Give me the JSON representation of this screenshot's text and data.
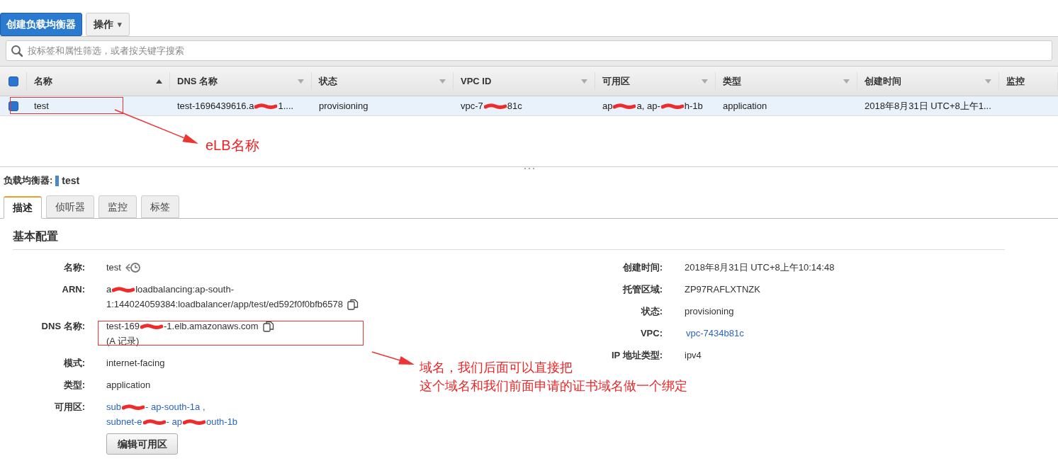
{
  "toolbar": {
    "create_button": "创建负载均衡器",
    "actions_button": {
      "label": "操作",
      "caret": "▾"
    }
  },
  "filter": {
    "placeholder": "按标签和属性筛选，或者按关键字搜索"
  },
  "table": {
    "select_all": {
      "checked": true
    },
    "columns": [
      {
        "label": "名称",
        "sorted": true
      },
      {
        "label": "DNS 名称",
        "sorted": false
      },
      {
        "label": "状态",
        "sorted": false
      },
      {
        "label": "VPC ID",
        "sorted": false
      },
      {
        "label": "可用区",
        "sorted": false
      },
      {
        "label": "类型",
        "sorted": false
      },
      {
        "label": "创建时间",
        "sorted": false
      },
      {
        "label": "监控"
      }
    ],
    "rows": [
      {
        "selected": true,
        "checked": true,
        "cells": [
          [
            {
              "kind": "text",
              "text": "test"
            }
          ],
          [
            {
              "kind": "text",
              "text": "test-1696439616.a"
            },
            {
              "kind": "redaction"
            },
            {
              "kind": "text",
              "text": "1...."
            }
          ],
          [
            {
              "kind": "text",
              "text": "provisioning"
            }
          ],
          [
            {
              "kind": "text",
              "text": "vpc-7"
            },
            {
              "kind": "redaction"
            },
            {
              "kind": "text",
              "text": "81c"
            }
          ],
          [
            {
              "kind": "text",
              "text": "ap"
            },
            {
              "kind": "redaction"
            },
            {
              "kind": "text",
              "text": "a, ap-"
            },
            {
              "kind": "redaction"
            },
            {
              "kind": "text",
              "text": "h-1b"
            }
          ],
          [
            {
              "kind": "text",
              "text": "application"
            }
          ],
          [
            {
              "kind": "text",
              "text": "2018年8月31日 UTC+8上午1..."
            }
          ],
          []
        ]
      }
    ]
  },
  "detail": {
    "label": "负载均衡器:",
    "name": "test",
    "tabs": [
      {
        "label": "描述",
        "selected": true
      },
      {
        "label": "侦听器",
        "selected": false
      },
      {
        "label": "监控",
        "selected": false
      },
      {
        "label": "标签",
        "selected": false
      }
    ],
    "section_title": "基本配置",
    "left_fields": [
      {
        "label": "名称:",
        "kind": "text",
        "lines": [
          [
            {
              "kind": "text",
              "text": "test"
            },
            {
              "kind": "history"
            }
          ]
        ]
      },
      {
        "label": "ARN:",
        "kind": "text",
        "lines": [
          [
            {
              "kind": "text",
              "text": "a"
            },
            {
              "kind": "redaction"
            },
            {
              "kind": "text",
              "text": "loadbalancing:ap-south-"
            }
          ],
          [
            {
              "kind": "text",
              "text": "1:144024059384:loadbalancer/app/test/ed592f0f0bfb6578"
            },
            {
              "kind": "copy"
            }
          ]
        ]
      },
      {
        "label": "DNS 名称:",
        "kind": "text",
        "lines": [
          [
            {
              "kind": "text",
              "text": "test-169"
            },
            {
              "kind": "redaction"
            },
            {
              "kind": "text",
              "text": "-1.elb.amazonaws.com"
            },
            {
              "kind": "copy"
            }
          ],
          [
            {
              "kind": "text",
              "text": "(A 记录)"
            }
          ]
        ]
      },
      {
        "label": "模式:",
        "kind": "text",
        "lines": [
          [
            {
              "kind": "text",
              "text": "internet-facing"
            }
          ]
        ]
      },
      {
        "label": "类型:",
        "kind": "text",
        "lines": [
          [
            {
              "kind": "text",
              "text": "application"
            }
          ]
        ]
      },
      {
        "label": "可用区:",
        "kind": "links",
        "lines": [
          [
            {
              "kind": "text",
              "text": "sub"
            },
            {
              "kind": "redaction"
            },
            {
              "kind": "text",
              "text": " - ap-south-1a ,"
            }
          ],
          [
            {
              "kind": "text",
              "text": "subnet-e"
            },
            {
              "kind": "redaction"
            },
            {
              "kind": "text",
              "text": " - ap"
            },
            {
              "kind": "redaction"
            },
            {
              "kind": "text",
              "text": "outh-1b"
            }
          ]
        ]
      }
    ],
    "edit_button": "编辑可用区",
    "right_fields": [
      {
        "label": "创建时间:",
        "kind": "text",
        "value": "2018年8月31日 UTC+8上午10:14:48"
      },
      {
        "label": "托管区域:",
        "kind": "text",
        "value": "ZP97RAFLXTNZK"
      },
      {
        "label": "状态:",
        "kind": "text",
        "value": "provisioning"
      },
      {
        "label": "VPC:",
        "kind": "link",
        "value": "vpc-7434b81c"
      },
      {
        "label": "IP 地址类型:",
        "kind": "text",
        "value": "ipv4"
      }
    ]
  },
  "annotations": [
    {
      "kind": "callout",
      "text": [
        "eLB名称"
      ]
    },
    {
      "kind": "callout",
      "text": [
        "域名，我们后面可以直接把",
        "这个域名和我们前面申请的证书域名做一个绑定"
      ]
    }
  ]
}
